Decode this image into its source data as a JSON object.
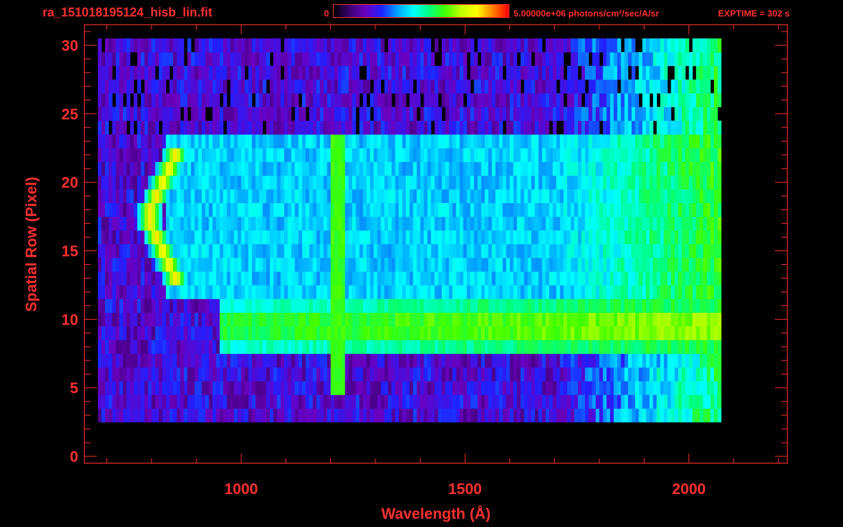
{
  "header": {
    "file_title": "ra_151018195124_hisb_lin.fit",
    "colorbar_min_label": "0",
    "colorbar_max_label": "5.00000e+06 photons/cm²/sec/A/sr",
    "exptime_label": "EXPTIME = 302 s"
  },
  "colors": {
    "text_accent": "#ff3030",
    "background": "#000000",
    "colormap": [
      "#000000",
      "#3a0070",
      "#6a00c0",
      "#2020ff",
      "#00a0ff",
      "#00ffff",
      "#00ff80",
      "#40ff00",
      "#c0ff00",
      "#ffff00",
      "#ff8000",
      "#ff0000"
    ]
  },
  "chart_data": {
    "type": "heatmap",
    "title": "ra_151018195124_hisb_lin.fit",
    "xlabel": "Wavelength (Å)",
    "ylabel": "Spatial Row (Pixel)",
    "xlim": [
      650,
      2220
    ],
    "ylim": [
      -0.5,
      31.5
    ],
    "x_ticks": [
      1000,
      1500,
      2000
    ],
    "y_ticks": [
      0,
      5,
      10,
      15,
      20,
      25,
      30
    ],
    "colorbar_range": [
      0,
      5000000
    ],
    "colorbar_units": "photons/cm²/sec/A/sr",
    "exptime_s": 302,
    "data_extent": {
      "x_range": [
        680,
        2070
      ],
      "rows_with_signal": [
        3,
        30
      ]
    },
    "features": [
      {
        "kind": "spectral continuum band",
        "rows": [
          8,
          11
        ],
        "x_range": [
          950,
          2070
        ],
        "level": 0.55
      },
      {
        "kind": "emission line",
        "x": 1216,
        "rows": [
          5,
          23
        ],
        "level": 0.6
      },
      {
        "kind": "curved arc feature",
        "x_range": [
          790,
          900
        ],
        "rows": [
          13,
          22
        ],
        "level": 0.85
      },
      {
        "kind": "diffuse background",
        "rows": [
          12,
          23
        ],
        "x_range": [
          830,
          2070
        ],
        "level": 0.35
      }
    ]
  }
}
